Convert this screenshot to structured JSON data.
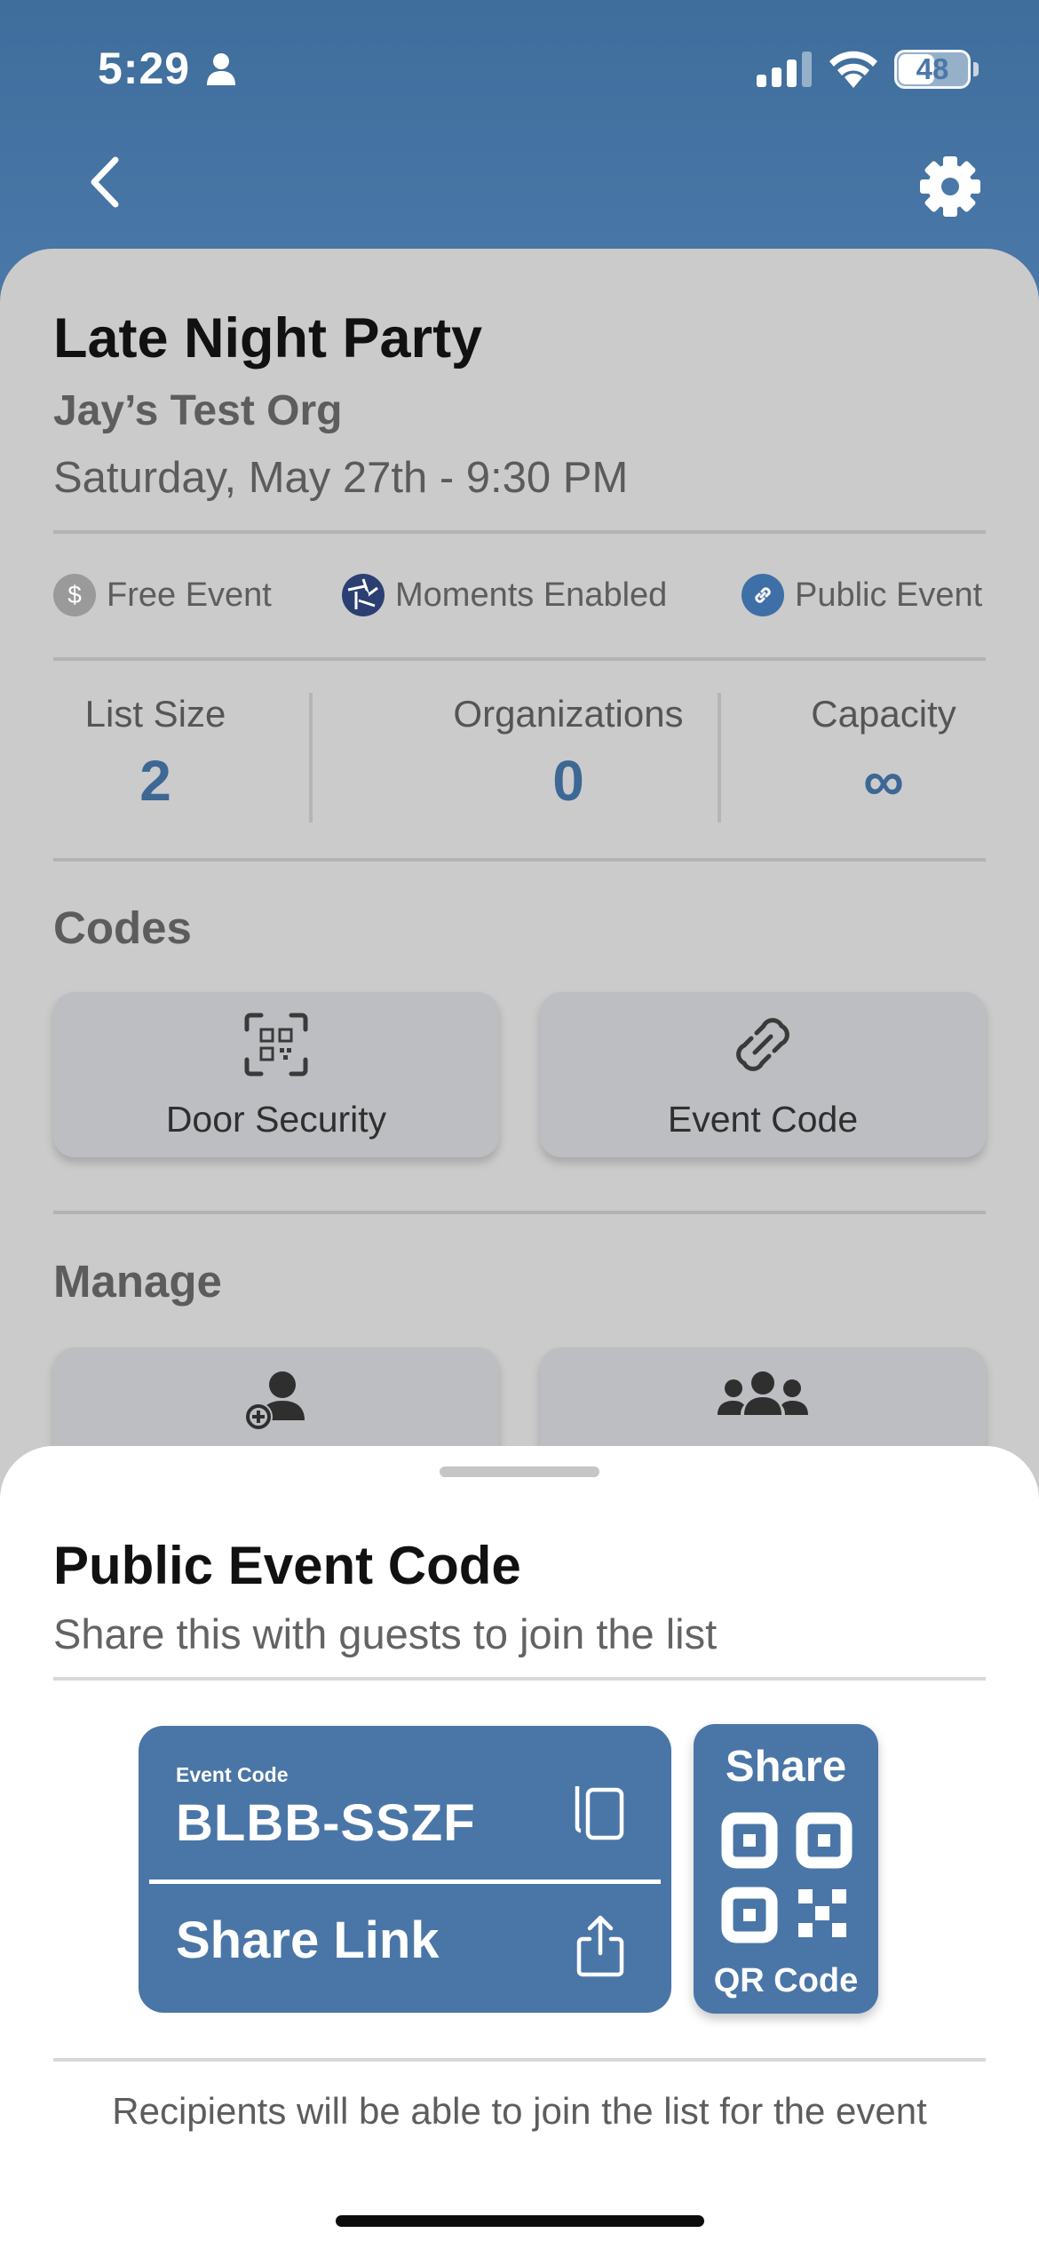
{
  "status_bar": {
    "time": "5:29",
    "battery": "48",
    "icons": [
      "person-icon",
      "cellular-signal-icon",
      "wifi-icon",
      "battery-icon"
    ]
  },
  "nav": {
    "back_icon": "chevron-left-icon",
    "settings_icon": "gear-icon"
  },
  "event": {
    "title": "Late Night Party",
    "organization": "Jay’s Test Org",
    "date": "Saturday, May 27th - 9:30 PM"
  },
  "tags": [
    {
      "label": "Free Event",
      "icon": "dollar-icon",
      "color": "#9a9a9a"
    },
    {
      "label": "Moments Enabled",
      "icon": "camera-aperture-icon",
      "color": "#2c3f73"
    },
    {
      "label": "Public Event",
      "icon": "link-icon",
      "color": "#3f6fa7"
    }
  ],
  "stats": [
    {
      "label": "List Size",
      "value": "2"
    },
    {
      "label": "Organizations",
      "value": "0"
    },
    {
      "label": "Capacity",
      "value": "∞"
    }
  ],
  "codes": {
    "title": "Codes",
    "tiles": [
      {
        "label": "Door Security",
        "icon": "qr-scan-icon"
      },
      {
        "label": "Event Code",
        "icon": "link-icon"
      }
    ]
  },
  "manage": {
    "title": "Manage",
    "tiles": [
      {
        "icon": "add-person-icon"
      },
      {
        "icon": "group-icon"
      }
    ]
  },
  "sheet": {
    "title": "Public Event Code",
    "subtitle": "Share this with guests to join the list",
    "code_caption": "Event Code",
    "code_value": "BLBB-SSZF",
    "share_link_label": "Share Link",
    "qr_share_label": "Share",
    "qr_code_label": "QR Code",
    "note": "Recipients will be able to join the list for the event"
  },
  "colors": {
    "header": "#4a78a8",
    "card_bg": "#cbcbcb",
    "accent": "#4a76a7",
    "stat_value": "#3d6794"
  }
}
